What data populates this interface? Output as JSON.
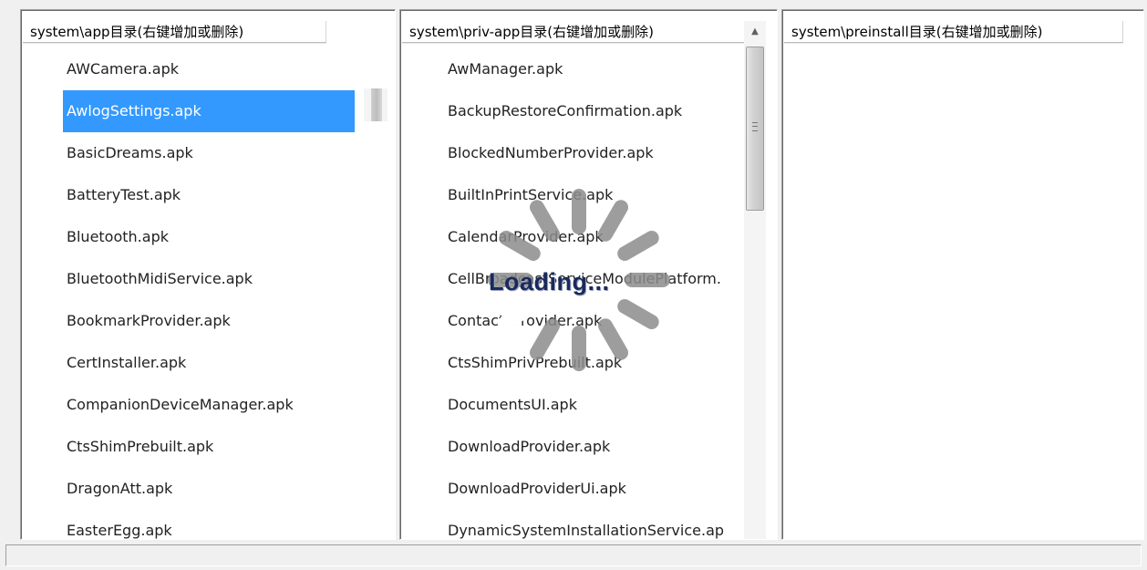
{
  "panels": {
    "app": {
      "header": "system\\app目录(右键增加或删除)",
      "items": [
        "AWCamera.apk",
        "AwlogSettings.apk",
        "BasicDreams.apk",
        "BatteryTest.apk",
        "Bluetooth.apk",
        "BluetoothMidiService.apk",
        "BookmarkProvider.apk",
        "CertInstaller.apk",
        "CompanionDeviceManager.apk",
        "CtsShimPrebuilt.apk",
        "DragonAtt.apk",
        "EasterEgg.apk"
      ],
      "selected_item": "AwlogSettings.apk"
    },
    "priv_app": {
      "header": "system\\priv-app目录(右键增加或删除)",
      "items": [
        "AwManager.apk",
        "BackupRestoreConfirmation.apk",
        "BlockedNumberProvider.apk",
        "BuiltInPrintService.apk",
        "CalendarProvider.apk",
        "CellBroadcastServiceModulePlatform.",
        "ContactsProvider.apk",
        "CtsShimPrivPrebuilt.apk",
        "DocumentsUI.apk",
        "DownloadProvider.apk",
        "DownloadProviderUi.apk",
        "DynamicSystemInstallationService.ap"
      ]
    },
    "preinstall": {
      "header": "system\\preinstall目录(右键增加或删除)",
      "items": []
    }
  },
  "loading": {
    "text": "Loading..."
  },
  "icons": {
    "scroll_up": "scroll-up-arrow-icon",
    "spinner": "loading-spinner-icon"
  },
  "colors": {
    "selection": "#3399ff",
    "background": "#f0f0f0"
  }
}
